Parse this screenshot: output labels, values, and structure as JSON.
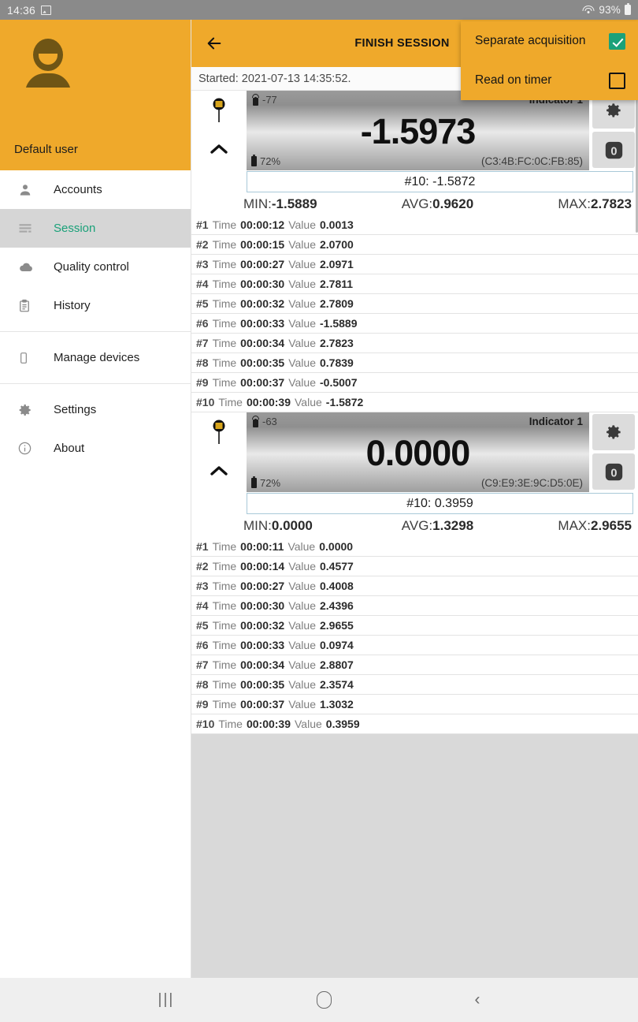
{
  "statusbar": {
    "time": "14:36",
    "battery_percent": "93%",
    "icons": [
      "image-icon",
      "wifi-icon",
      "battery-icon"
    ]
  },
  "drawer": {
    "user_name": "Default user",
    "avatar_icon": "user-avatar-icon",
    "items": [
      {
        "label": "Accounts",
        "icon": "person-icon",
        "selected": false
      },
      {
        "label": "Session",
        "icon": "list-icon",
        "selected": true
      },
      {
        "label": "Quality control",
        "icon": "cloud-icon",
        "selected": false
      },
      {
        "label": "History",
        "icon": "clipboard-icon",
        "selected": false
      },
      {
        "label": "Manage devices",
        "icon": "phone-icon",
        "selected": false
      },
      {
        "label": "Settings",
        "icon": "gear-icon",
        "selected": false
      },
      {
        "label": "About",
        "icon": "info-icon",
        "selected": false
      }
    ]
  },
  "toolbar": {
    "back_icon": "arrow-left-icon",
    "title": "FINISH SESSION",
    "chart_icon": "chart-line-icon"
  },
  "menu": {
    "items": [
      {
        "label": "Separate acquisition",
        "checked": true
      },
      {
        "label": "Read on timer",
        "checked": false
      }
    ]
  },
  "session": {
    "started_text": "Started: 2021-07-13 14:35:52."
  },
  "indicators": [
    {
      "rssi": "-77",
      "name": "Indicator 1",
      "value": "-1.5973",
      "battery": "72%",
      "mac": "(C3:4B:FC:0C:FB:85)",
      "last_read": "#10: -1.5872",
      "stats": {
        "min_label": "MIN:",
        "min": "-1.5889",
        "avg_label": "AVG:",
        "avg": "0.9620",
        "max_label": "MAX:",
        "max": "2.7823"
      },
      "time_label": "Time",
      "value_label": "Value",
      "readings": [
        {
          "num": "#1",
          "time": "00:00:12",
          "value": "0.0013"
        },
        {
          "num": "#2",
          "time": "00:00:15",
          "value": "2.0700"
        },
        {
          "num": "#3",
          "time": "00:00:27",
          "value": "2.0971"
        },
        {
          "num": "#4",
          "time": "00:00:30",
          "value": "2.7811"
        },
        {
          "num": "#5",
          "time": "00:00:32",
          "value": "2.7809"
        },
        {
          "num": "#6",
          "time": "00:00:33",
          "value": "-1.5889"
        },
        {
          "num": "#7",
          "time": "00:00:34",
          "value": "2.7823"
        },
        {
          "num": "#8",
          "time": "00:00:35",
          "value": "0.7839"
        },
        {
          "num": "#9",
          "time": "00:00:37",
          "value": "-0.5007"
        },
        {
          "num": "#10",
          "time": "00:00:39",
          "value": "-1.5872"
        }
      ]
    },
    {
      "rssi": "-63",
      "name": "Indicator 1",
      "value": "0.0000",
      "battery": "72%",
      "mac": "(C9:E9:3E:9C:D5:0E)",
      "last_read": "#10: 0.3959",
      "stats": {
        "min_label": "MIN:",
        "min": "0.0000",
        "avg_label": "AVG:",
        "avg": "1.3298",
        "max_label": "MAX:",
        "max": "2.9655"
      },
      "time_label": "Time",
      "value_label": "Value",
      "readings": [
        {
          "num": "#1",
          "time": "00:00:11",
          "value": "0.0000"
        },
        {
          "num": "#2",
          "time": "00:00:14",
          "value": "0.4577"
        },
        {
          "num": "#3",
          "time": "00:00:27",
          "value": "0.4008"
        },
        {
          "num": "#4",
          "time": "00:00:30",
          "value": "2.4396"
        },
        {
          "num": "#5",
          "time": "00:00:32",
          "value": "2.9655"
        },
        {
          "num": "#6",
          "time": "00:00:33",
          "value": "0.0974"
        },
        {
          "num": "#7",
          "time": "00:00:34",
          "value": "2.8807"
        },
        {
          "num": "#8",
          "time": "00:00:35",
          "value": "2.3574"
        },
        {
          "num": "#9",
          "time": "00:00:37",
          "value": "1.3032"
        },
        {
          "num": "#10",
          "time": "00:00:39",
          "value": "0.3959"
        }
      ]
    }
  ],
  "sysnav": {
    "recents": "|||",
    "home": "",
    "back": "‹"
  },
  "colors": {
    "accent": "#efa92b",
    "selected_text": "#1aa179",
    "checkbox_checked": "#1aa179",
    "statusbar": "#8a8a8a",
    "content_bg": "#d9d9d9"
  }
}
